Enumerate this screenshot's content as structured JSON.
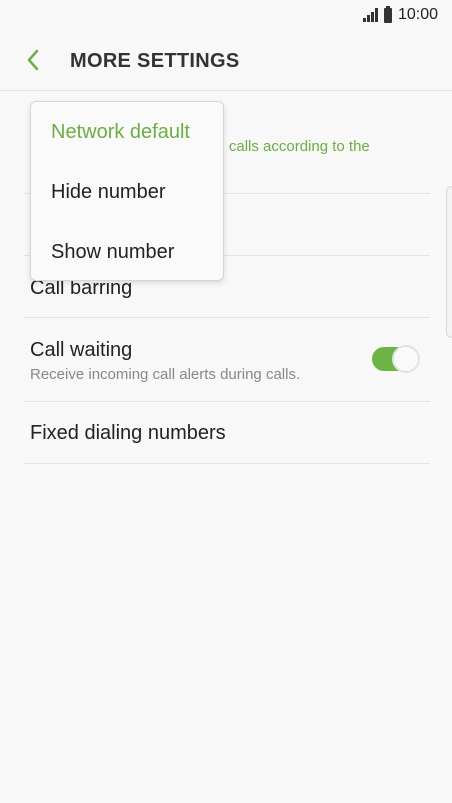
{
  "status_bar": {
    "time": "10:00",
    "icons": [
      "signal-icon",
      "battery-icon"
    ]
  },
  "header": {
    "back_icon": "back-arrow-icon",
    "title": "MORE SETTINGS"
  },
  "colors": {
    "accent": "#6cae43",
    "toggle_on": "#6cb544",
    "background": "#f8f8f8"
  },
  "settings": {
    "caller_id_sub_visible": "ng calls according to the",
    "call_barring": "Call barring",
    "call_waiting": {
      "title": "Call waiting",
      "subtitle": "Receive incoming call alerts during calls.",
      "enabled": true
    },
    "fixed_dialing": "Fixed dialing numbers"
  },
  "popup": {
    "selected": "Network default",
    "options": [
      "Network default",
      "Hide number",
      "Show number"
    ]
  }
}
